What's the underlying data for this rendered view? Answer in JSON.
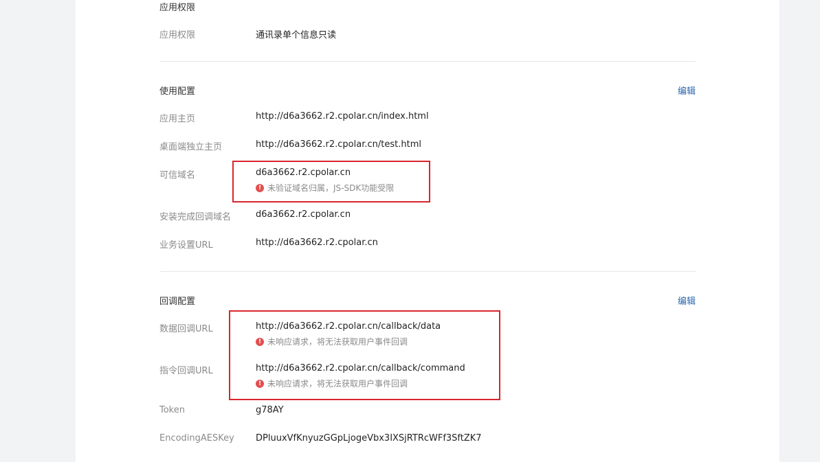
{
  "permissions": {
    "section_title": "应用权限",
    "label": "应用权限",
    "value": "通讯录单个信息只读"
  },
  "usage_config": {
    "section_title": "使用配置",
    "edit_label": "编辑",
    "home_label": "应用主页",
    "home_value": "http://d6a3662.r2.cpolar.cn/index.html",
    "desktop_label": "桌面端独立主页",
    "desktop_value": "http://d6a3662.r2.cpolar.cn/test.html",
    "trusted_domain_label": "可信域名",
    "trusted_domain_value": "d6a3662.r2.cpolar.cn",
    "trusted_domain_warning": "未验证域名归属，JS-SDK功能受限",
    "install_callback_label": "安装完成回调域名",
    "install_callback_value": "d6a3662.r2.cpolar.cn",
    "business_url_label": "业务设置URL",
    "business_url_value": "http://d6a3662.r2.cpolar.cn"
  },
  "callback_config": {
    "section_title": "回调配置",
    "edit_label": "编辑",
    "data_url_label": "数据回调URL",
    "data_url_value": "http://d6a3662.r2.cpolar.cn/callback/data",
    "data_url_warning": "未响应请求，将无法获取用户事件回调",
    "command_url_label": "指令回调URL",
    "command_url_value": "http://d6a3662.r2.cpolar.cn/callback/command",
    "command_url_warning": "未响应请求，将无法获取用户事件回调",
    "token_label": "Token",
    "token_value": "g78AY",
    "aes_label": "EncodingAESKey",
    "aes_value": "DPluuxVfKnyuzGGpLjogeVbx3IXSjRTRcWFf3SftZK7"
  },
  "icons": {
    "warning": "warning-circle-icon",
    "warning_glyph": "!"
  },
  "colors": {
    "link": "#2b66ad",
    "warning": "#e25050",
    "annotation": "#d9242b"
  }
}
